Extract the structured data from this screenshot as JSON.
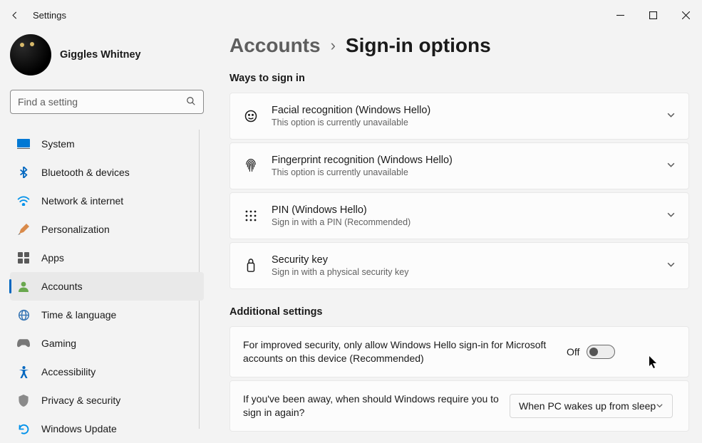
{
  "window": {
    "title": "Settings"
  },
  "profile": {
    "name": "Giggles Whitney"
  },
  "search": {
    "placeholder": "Find a setting"
  },
  "nav": {
    "system": "System",
    "bluetooth": "Bluetooth & devices",
    "network": "Network & internet",
    "personalization": "Personalization",
    "apps": "Apps",
    "accounts": "Accounts",
    "time": "Time & language",
    "gaming": "Gaming",
    "accessibility": "Accessibility",
    "privacy": "Privacy & security",
    "update": "Windows Update"
  },
  "breadcrumb": {
    "parent": "Accounts",
    "current": "Sign-in options"
  },
  "sections": {
    "ways_label": "Ways to sign in",
    "additional_label": "Additional settings"
  },
  "signin_options": {
    "facial": {
      "title": "Facial recognition (Windows Hello)",
      "sub": "This option is currently unavailable"
    },
    "fingerprint": {
      "title": "Fingerprint recognition (Windows Hello)",
      "sub": "This option is currently unavailable"
    },
    "pin": {
      "title": "PIN (Windows Hello)",
      "sub": "Sign in with a PIN (Recommended)"
    },
    "security_key": {
      "title": "Security key",
      "sub": "Sign in with a physical security key"
    }
  },
  "additional": {
    "hello_only": {
      "text": "For improved security, only allow Windows Hello sign-in for Microsoft accounts on this device (Recommended)",
      "state_label": "Off"
    },
    "require_signin": {
      "text": "If you've been away, when should Windows require you to sign in again?",
      "selected": "When PC wakes up from sleep"
    }
  }
}
